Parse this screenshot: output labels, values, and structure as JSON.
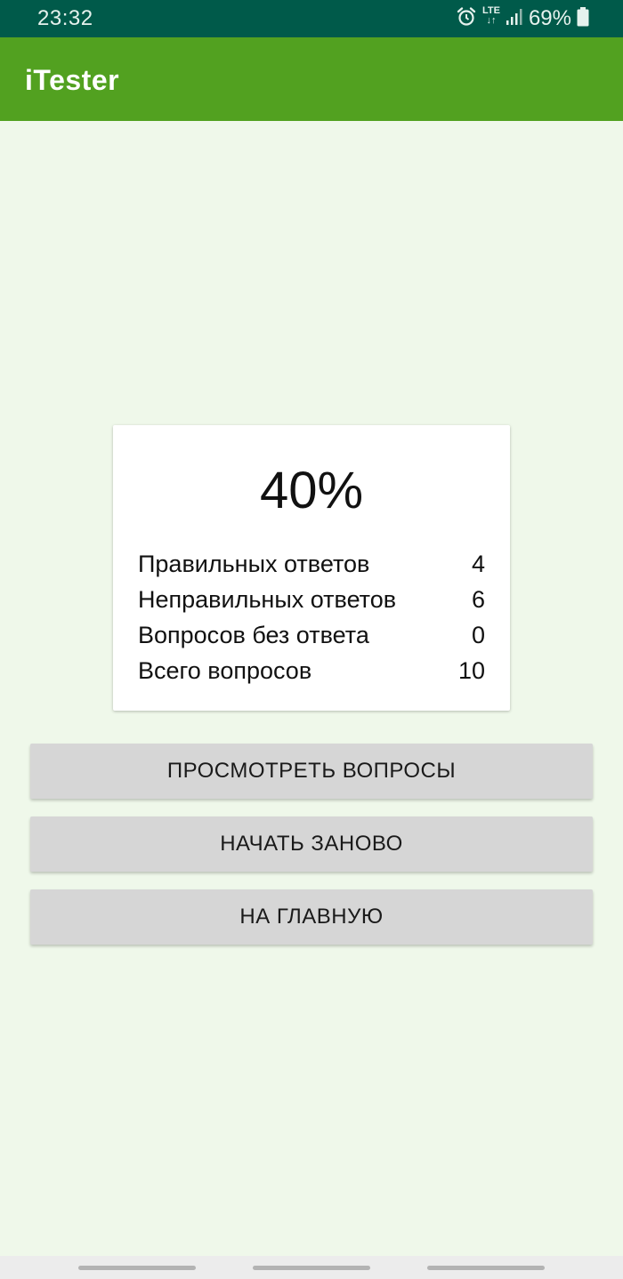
{
  "status_bar": {
    "time": "23:32",
    "network": "LTE",
    "battery": "69%",
    "icons": [
      "alarm-icon",
      "lte-icon",
      "signal-icon",
      "battery-icon"
    ]
  },
  "app_bar": {
    "title": "iTester",
    "color": "#52a120"
  },
  "result": {
    "percent": "40%",
    "rows": [
      {
        "label": "Правильных ответов",
        "value": "4"
      },
      {
        "label": "Неправильных ответов",
        "value": "6"
      },
      {
        "label": "Вопросов без ответа",
        "value": "0"
      },
      {
        "label": "Всего вопросов",
        "value": "10"
      }
    ]
  },
  "actions": {
    "review": "ПРОСМОТРЕТЬ ВОПРОСЫ",
    "restart": "НАЧАТЬ ЗАНОВО",
    "home": "НА ГЛАВНУЮ"
  }
}
